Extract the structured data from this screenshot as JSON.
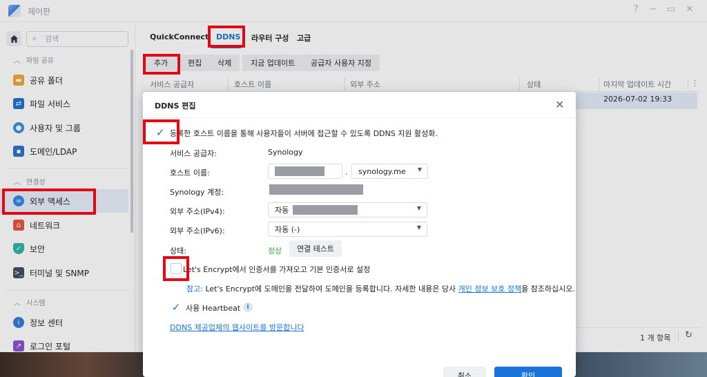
{
  "window": {
    "title": "제어판",
    "controls": [
      "?",
      "−",
      "▭",
      "✕"
    ]
  },
  "sidebar": {
    "search_placeholder": "검색",
    "sections": [
      {
        "label": "파일 공유"
      },
      {
        "label": "연결성"
      },
      {
        "label": "시스템"
      }
    ],
    "items": [
      {
        "label": "공유 폴더",
        "icon": "folder-icon",
        "color": "#f0a531"
      },
      {
        "label": "파일 서비스",
        "icon": "file-services-icon",
        "color": "#1f6fd1"
      },
      {
        "label": "사용자 및 그룹",
        "icon": "users-icon",
        "color": "#3a8be0"
      },
      {
        "label": "도메인/LDAP",
        "icon": "domain-icon",
        "color": "#2b6fc9"
      },
      {
        "label": "외부 액세스",
        "icon": "external-access-icon",
        "color": "#2f86e3"
      },
      {
        "label": "네트워크",
        "icon": "network-icon",
        "color": "#e2543b"
      },
      {
        "label": "보안",
        "icon": "security-icon",
        "color": "#2fb3a4"
      },
      {
        "label": "터미널 및 SNMP",
        "icon": "terminal-icon",
        "color": "#3f4b5c"
      },
      {
        "label": "정보 센터",
        "icon": "info-center-icon",
        "color": "#2c7be0"
      },
      {
        "label": "로그인 포털",
        "icon": "login-portal-icon",
        "color": "#8a4fd0"
      }
    ]
  },
  "tabs": [
    "QuickConnect",
    "DDNS",
    "라우터 구성",
    "고급"
  ],
  "toolbar": [
    "추가",
    "편집",
    "삭제",
    "지금 업데이트",
    "공급자 사용자 지정"
  ],
  "grid": {
    "columns": [
      "서비스 공급자",
      "호스트 이름",
      "외부 주소",
      "상태",
      "마지막 업데이트 시간"
    ],
    "row": {
      "last_update": "2026-07-02 19:33"
    },
    "count": "1 개 항목"
  },
  "dialog": {
    "title": "DDNS 편집",
    "enable_label": "등록한 호스트 이름을 통해 사용자들이 서버에 접근할 수 있도록 DDNS 지원 활성화.",
    "provider_label": "서비스 공급자:",
    "provider_value": "Synology",
    "hostname_label": "호스트 이름:",
    "domain_value": "synology.me",
    "account_label": "Synology 계정:",
    "ipv4_label": "외부 주소(IPv4):",
    "ipv4_value": "자동",
    "ipv6_label": "외부 주소(IPv6):",
    "ipv6_value": "자동 (-)",
    "status_label": "상태:",
    "status_value": "정상",
    "test_button": "연결 테스트",
    "letsencrypt_label": "Let's Encrypt에서 인증서를 가져오고 기본 인증서로 설정",
    "note_tag": "참고:",
    "note_text": "Let's Encrypt에 도메인을 전달하여 도메인을 등록합니다. 자세한 내용은 당사",
    "note_link": "개인 정보 보호 정책",
    "note_suffix": "을 참조하십시오.",
    "heartbeat_label": "사용 Heartbeat",
    "visit_link": "DDNS 제공업체의 웹사이트를 방문합니다",
    "cancel": "취소",
    "ok": "확인"
  },
  "colors": {
    "accent": "#1a73d9",
    "highlight": "#e30613",
    "ok": "#3da63b"
  }
}
